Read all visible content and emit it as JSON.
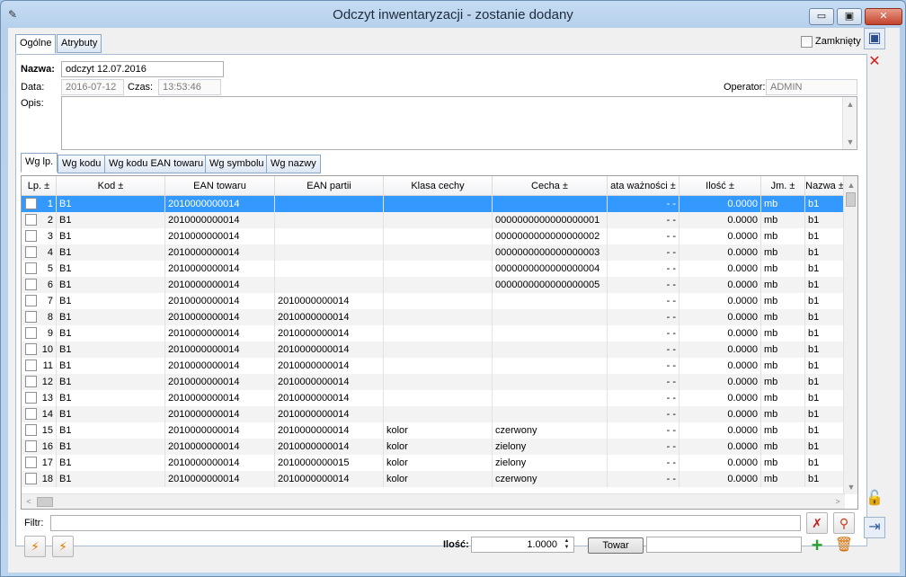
{
  "window": {
    "title": "Odczyt inwentaryzacji - zostanie dodany",
    "min_label": "▭",
    "max_label": "▣",
    "close_label": "✕"
  },
  "main_tabs": [
    {
      "label": "Ogólne"
    },
    {
      "label": "Atrybuty"
    }
  ],
  "closed_checkbox": {
    "label": "Zamknięty",
    "checked": false
  },
  "form": {
    "name_label": "Nazwa:",
    "name_value": "odczyt 12.07.2016",
    "date_label": "Data:",
    "date_value": "2016-07-12",
    "time_label": "Czas:",
    "time_value": "13:53:46",
    "operator_label": "Operator:",
    "operator_value": "ADMIN",
    "description_label": "Opis:",
    "description_value": ""
  },
  "sub_tabs": [
    {
      "label": "Wg lp."
    },
    {
      "label": "Wg kodu"
    },
    {
      "label": "Wg kodu EAN towaru"
    },
    {
      "label": "Wg symbolu"
    },
    {
      "label": "Wg nazwy"
    }
  ],
  "grid": {
    "columns": [
      "Lp. ±",
      "Kod ±",
      "EAN towaru",
      "EAN partii",
      "Klasa cechy",
      "Cecha ±",
      "ata ważności ±",
      "Ilość ±",
      "Jm. ±",
      "Nazwa ±"
    ],
    "rows": [
      [
        "1",
        "B1",
        "2010000000014",
        "",
        "",
        "",
        "- -",
        "0.0000",
        "mb",
        "b1"
      ],
      [
        "2",
        "B1",
        "2010000000014",
        "",
        "",
        "0000000000000000001",
        "- -",
        "0.0000",
        "mb",
        "b1"
      ],
      [
        "3",
        "B1",
        "2010000000014",
        "",
        "",
        "0000000000000000002",
        "- -",
        "0.0000",
        "mb",
        "b1"
      ],
      [
        "4",
        "B1",
        "2010000000014",
        "",
        "",
        "0000000000000000003",
        "- -",
        "0.0000",
        "mb",
        "b1"
      ],
      [
        "5",
        "B1",
        "2010000000014",
        "",
        "",
        "0000000000000000004",
        "- -",
        "0.0000",
        "mb",
        "b1"
      ],
      [
        "6",
        "B1",
        "2010000000014",
        "",
        "",
        "0000000000000000005",
        "- -",
        "0.0000",
        "mb",
        "b1"
      ],
      [
        "7",
        "B1",
        "2010000000014",
        "2010000000014",
        "",
        "",
        "- -",
        "0.0000",
        "mb",
        "b1"
      ],
      [
        "8",
        "B1",
        "2010000000014",
        "2010000000014",
        "",
        "",
        "- -",
        "0.0000",
        "mb",
        "b1"
      ],
      [
        "9",
        "B1",
        "2010000000014",
        "2010000000014",
        "",
        "",
        "- -",
        "0.0000",
        "mb",
        "b1"
      ],
      [
        "10",
        "B1",
        "2010000000014",
        "2010000000014",
        "",
        "",
        "- -",
        "0.0000",
        "mb",
        "b1"
      ],
      [
        "11",
        "B1",
        "2010000000014",
        "2010000000014",
        "",
        "",
        "- -",
        "0.0000",
        "mb",
        "b1"
      ],
      [
        "12",
        "B1",
        "2010000000014",
        "2010000000014",
        "",
        "",
        "- -",
        "0.0000",
        "mb",
        "b1"
      ],
      [
        "13",
        "B1",
        "2010000000014",
        "2010000000014",
        "",
        "",
        "- -",
        "0.0000",
        "mb",
        "b1"
      ],
      [
        "14",
        "B1",
        "2010000000014",
        "2010000000014",
        "",
        "",
        "- -",
        "0.0000",
        "mb",
        "b1"
      ],
      [
        "15",
        "B1",
        "2010000000014",
        "2010000000014",
        "kolor",
        "czerwony",
        "- -",
        "0.0000",
        "mb",
        "b1"
      ],
      [
        "16",
        "B1",
        "2010000000014",
        "2010000000014",
        "kolor",
        "zielony",
        "- -",
        "0.0000",
        "mb",
        "b1"
      ],
      [
        "17",
        "B1",
        "2010000000014",
        "2010000000015",
        "kolor",
        "zielony",
        "- -",
        "0.0000",
        "mb",
        "b1"
      ],
      [
        "18",
        "B1",
        "2010000000014",
        "2010000000014",
        "kolor",
        "czerwony",
        "- -",
        "0.0000",
        "mb",
        "b1"
      ]
    ],
    "selected_row": 0
  },
  "filter": {
    "label": "Filtr:",
    "value": ""
  },
  "quantity": {
    "label": "Ilość:",
    "value": "1.0000"
  },
  "product_button": {
    "label": "Towar"
  },
  "product_field": {
    "value": ""
  },
  "colors": {
    "selection": "#3399ff",
    "accent": "#2b4f91",
    "danger": "#d21d1d",
    "add": "#2ea02e"
  }
}
